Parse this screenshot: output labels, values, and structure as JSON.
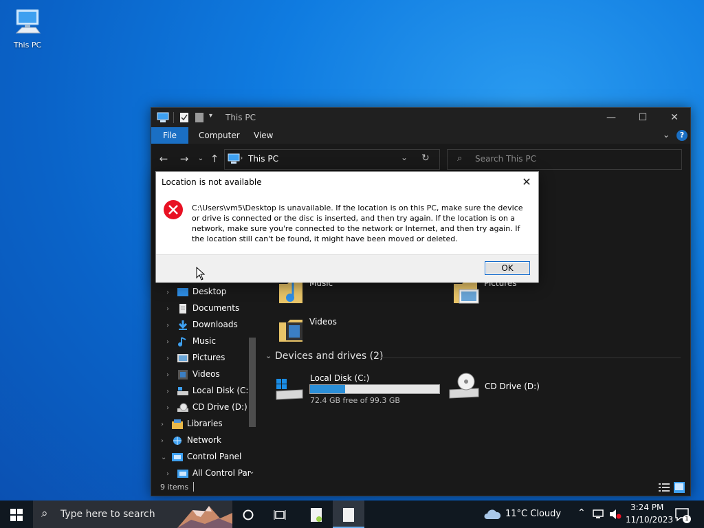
{
  "desktop": {
    "icons": [
      {
        "label": "This PC",
        "icon": "computer-icon"
      }
    ]
  },
  "explorer": {
    "title": "This PC",
    "ribbon_tabs": [
      "File",
      "Computer",
      "View"
    ],
    "address": {
      "path": "This PC"
    },
    "search": {
      "placeholder": "Search This PC"
    },
    "nav_items": [
      {
        "label": "Desktop",
        "icon": "desktop-folder-icon"
      },
      {
        "label": "Documents",
        "icon": "documents-icon"
      },
      {
        "label": "Downloads",
        "icon": "downloads-icon"
      },
      {
        "label": "Music",
        "icon": "music-icon"
      },
      {
        "label": "Pictures",
        "icon": "pictures-icon"
      },
      {
        "label": "Videos",
        "icon": "videos-icon"
      },
      {
        "label": "Local Disk (C:)",
        "icon": "drive-icon"
      },
      {
        "label": "CD Drive (D:)",
        "icon": "cd-drive-icon"
      },
      {
        "label": "Libraries",
        "icon": "libraries-icon"
      },
      {
        "label": "Network",
        "icon": "network-icon"
      },
      {
        "label": "Control Panel",
        "icon": "control-panel-icon"
      },
      {
        "label": "All Control Par",
        "icon": "control-panel-icon"
      }
    ],
    "folders": [
      {
        "label": "Music",
        "icon": "music-folder-icon"
      },
      {
        "label": "Pictures",
        "icon": "pictures-folder-icon"
      },
      {
        "label": "Videos",
        "icon": "videos-folder-icon"
      }
    ],
    "devices_section": "Devices and drives (2)",
    "drives": [
      {
        "label": "Local Disk (C:)",
        "free_text": "72.4 GB free of 99.3 GB",
        "used_fraction": 0.271
      },
      {
        "label": "CD Drive (D:)"
      }
    ],
    "status": {
      "items": "9 items"
    }
  },
  "dialog": {
    "title": "Location is not available",
    "message": "C:\\Users\\vm5\\Desktop is unavailable. If the location is on this PC, make sure the device or drive is connected or the disc is inserted, and then try again. If the location is on a network, make sure you're connected to the network or Internet, and then try again. If the location still can't be found, it might have been moved or deleted.",
    "ok_label": "OK"
  },
  "taskbar": {
    "search_placeholder": "Type here to search",
    "weather": "11°C  Cloudy",
    "time": "3:24 PM",
    "date": "11/10/2023",
    "notification_count": "1"
  },
  "colors": {
    "accent": "#1a6fc4",
    "error": "#e81123",
    "window_bg": "#191919"
  }
}
